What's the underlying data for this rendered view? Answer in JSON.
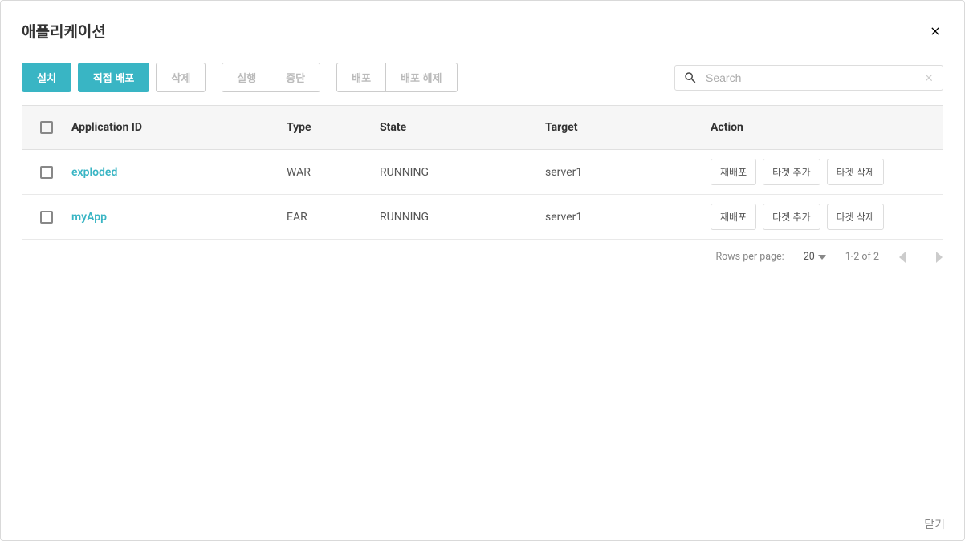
{
  "modal": {
    "title": "애플리케이션",
    "close_label": "닫기"
  },
  "toolbar": {
    "install": "설치",
    "direct_deploy": "직접 배포",
    "delete": "삭제",
    "run": "실행",
    "stop": "중단",
    "deploy": "배포",
    "undeploy": "배포 해제"
  },
  "search": {
    "placeholder": "Search"
  },
  "table": {
    "headers": {
      "app_id": "Application ID",
      "type": "Type",
      "state": "State",
      "target": "Target",
      "action": "Action"
    },
    "actions": {
      "redeploy": "재배포",
      "add_target": "타겟 추가",
      "delete_target": "타겟 삭제"
    },
    "rows": [
      {
        "app_id": "exploded",
        "type": "WAR",
        "state": "RUNNING",
        "target": "server1"
      },
      {
        "app_id": "myApp",
        "type": "EAR",
        "state": "RUNNING",
        "target": "server1"
      }
    ]
  },
  "pagination": {
    "rows_per_page_label": "Rows per page:",
    "rows_per_page_value": "20",
    "range": "1-2 of 2"
  }
}
